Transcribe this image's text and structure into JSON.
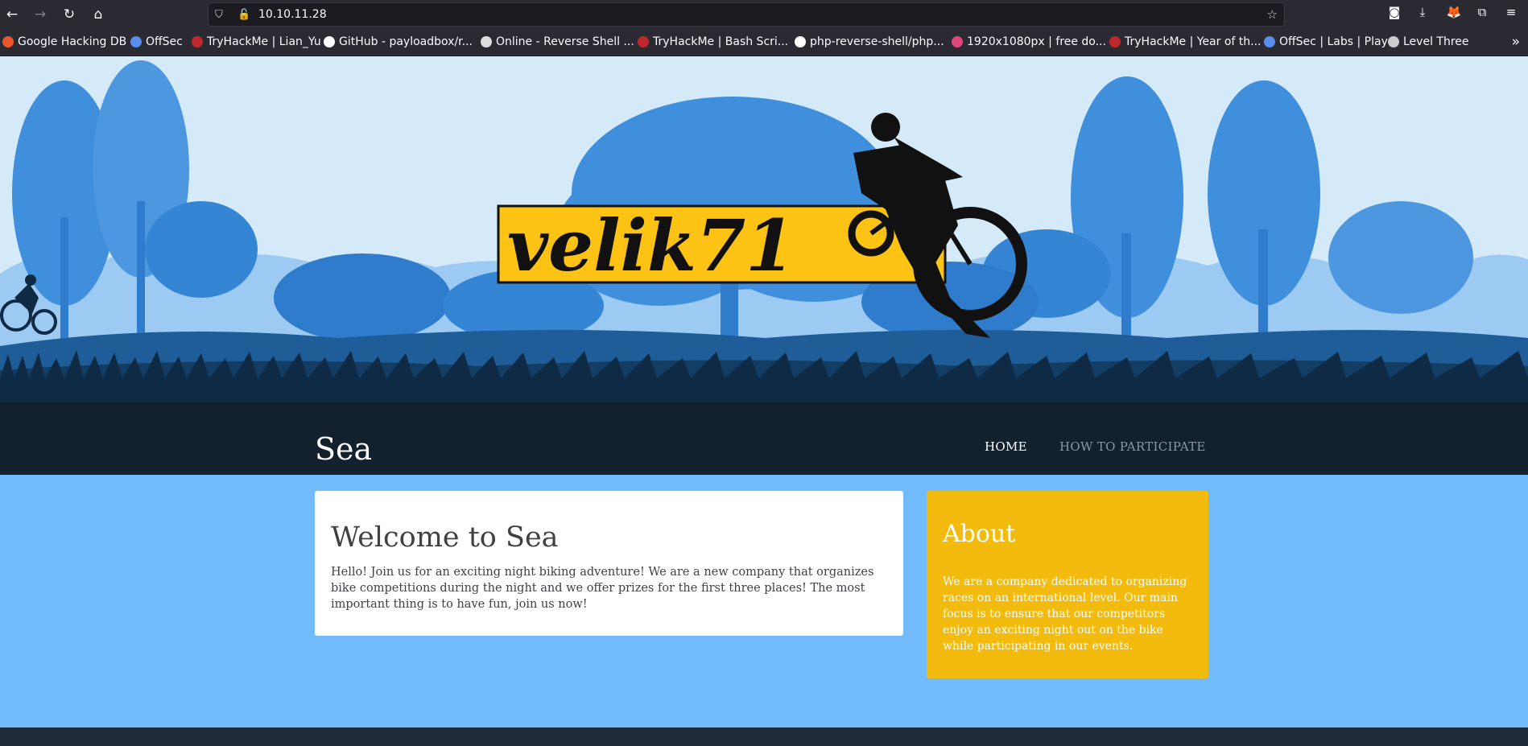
{
  "browser": {
    "url": "10.10.11.28",
    "bookmarks": [
      {
        "label": "Google Hacking DB",
        "color": "#e8562a"
      },
      {
        "label": "OffSec",
        "color": "#5b8def"
      },
      {
        "label": "TryHackMe | Lian_Yu",
        "color": "#c0282d"
      },
      {
        "label": "GitHub - payloadbox/r...",
        "color": "#ffffff"
      },
      {
        "label": "Online - Reverse Shell ...",
        "color": "#dddddd"
      },
      {
        "label": "TryHackMe | Bash Scri...",
        "color": "#c0282d"
      },
      {
        "label": "php-reverse-shell/php...",
        "color": "#ffffff"
      },
      {
        "label": "1920x1080px | free do...",
        "color": "#e0457b"
      },
      {
        "label": "TryHackMe | Year of th...",
        "color": "#c0282d"
      },
      {
        "label": "OffSec | Labs | Play",
        "color": "#5b8def"
      },
      {
        "label": "Level Three",
        "color": "#cccccc"
      }
    ]
  },
  "site": {
    "logo_text": "velik71",
    "title": "Sea",
    "nav": {
      "home": "HOME",
      "participate": "HOW TO PARTICIPATE"
    }
  },
  "main": {
    "heading": "Welcome to Sea",
    "body": "Hello! Join us for an exciting night biking adventure! We are a new company that organizes bike competitions during the night and we offer prizes for the first three places! The most important thing is to have fun, join us now!"
  },
  "about": {
    "heading": "About",
    "body": "We are a company dedicated to organizing races on an international level. Our main focus is to ensure that our competitors enjoy an exciting night out on the bike while participating in our events."
  },
  "colors": {
    "hero_sky": "#d4eaf8",
    "hero_dark": "#13202e",
    "content_bg": "#72bbfb",
    "about_bg": "#f3bb0d",
    "logo_yellow": "#fcc314"
  }
}
